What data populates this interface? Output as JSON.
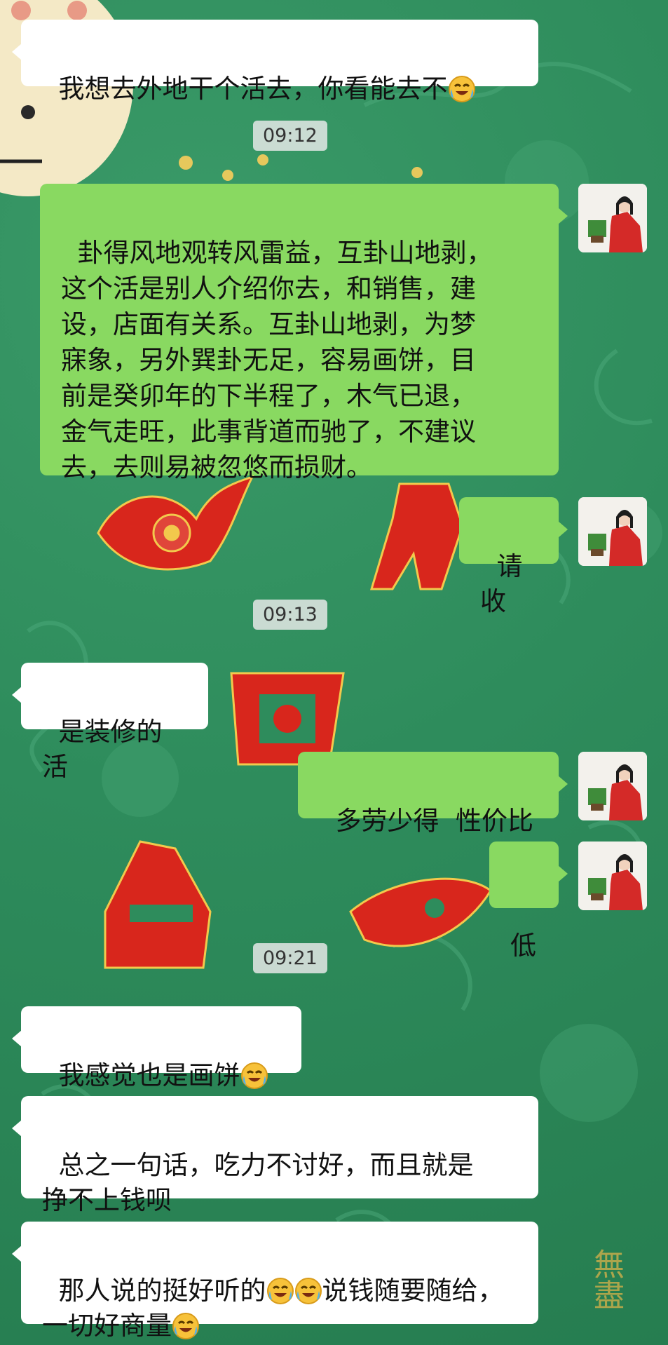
{
  "colors": {
    "background": "#2e8c5c",
    "bubble_incoming": "#ffffff",
    "bubble_outgoing": "#89d961",
    "glyph_red": "#d8261c"
  },
  "messages": [
    {
      "side": "left",
      "text": "我想去外地干个活去，你看能去不",
      "emoji_suffix": [
        "crying-laughing-emoji"
      ]
    },
    {
      "type": "time",
      "text": "09:12"
    },
    {
      "side": "right",
      "text": "卦得风地观转风雷益，互卦山地剥，\n这个活是别人介绍你去，和销售，建\n设，店面有关系。互卦山地剥，为梦\n寐象，另外巽卦无足，容易画饼，目\n前是癸卯年的下半程了，木气已退，\n金气走旺，此事背道而驰了，不建议\n去，去则易被忽悠而损财。"
    },
    {
      "side": "right",
      "text": "请收"
    },
    {
      "type": "time",
      "text": "09:13"
    },
    {
      "side": "left",
      "text": "是装修的活"
    },
    {
      "side": "right",
      "text": "多劳少得  性价比"
    },
    {
      "side": "right",
      "text": "低"
    },
    {
      "type": "time",
      "text": "09:21"
    },
    {
      "side": "left",
      "text": "我感觉也是画饼"
    },
    {
      "side": "left",
      "text": "总之一句话，吃力不讨好，而且就是\n挣不上钱呗"
    },
    {
      "side": "left",
      "text": "那人说的挺好听的"
    },
    {
      "side": "left",
      "text": "说钱随要随给，\n一切好商量"
    }
  ],
  "watermark_text": "無盡"
}
